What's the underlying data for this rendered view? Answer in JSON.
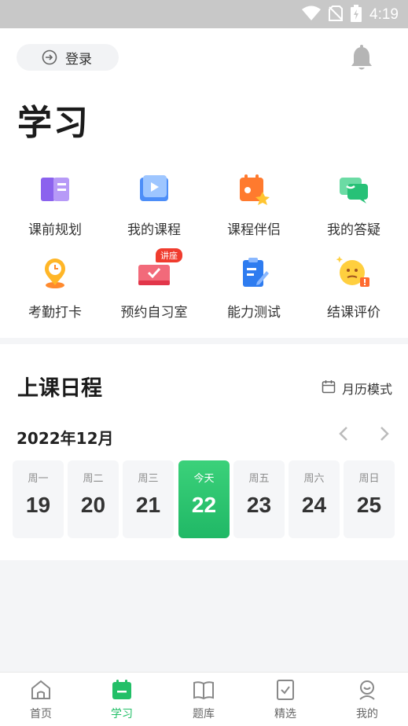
{
  "status_bar": {
    "time": "4:19"
  },
  "header": {
    "login_label": "登录",
    "title": "学习"
  },
  "grid": [
    {
      "label": "课前规划",
      "icon": "plan-icon"
    },
    {
      "label": "我的课程",
      "icon": "video-course-icon"
    },
    {
      "label": "课程伴侣",
      "icon": "companion-icon"
    },
    {
      "label": "我的答疑",
      "icon": "chat-qa-icon"
    },
    {
      "label": "考勤打卡",
      "icon": "clock-pin-icon"
    },
    {
      "label": "预约自习室",
      "icon": "study-room-icon",
      "badge": "讲座"
    },
    {
      "label": "能力测试",
      "icon": "clipboard-test-icon"
    },
    {
      "label": "结课评价",
      "icon": "rating-face-icon"
    }
  ],
  "schedule": {
    "title": "上课日程",
    "mode_label": "月历模式",
    "month": "2022年12月",
    "days": [
      {
        "weekday": "周一",
        "date": "19"
      },
      {
        "weekday": "周二",
        "date": "20"
      },
      {
        "weekday": "周三",
        "date": "21"
      },
      {
        "weekday": "今天",
        "date": "22",
        "today": true
      },
      {
        "weekday": "周五",
        "date": "23"
      },
      {
        "weekday": "周六",
        "date": "24"
      },
      {
        "weekday": "周日",
        "date": "25"
      }
    ]
  },
  "tabbar": [
    {
      "label": "首页",
      "icon": "home-icon"
    },
    {
      "label": "学习",
      "icon": "study-icon",
      "active": true
    },
    {
      "label": "题库",
      "icon": "book-icon"
    },
    {
      "label": "精选",
      "icon": "selected-icon"
    },
    {
      "label": "我的",
      "icon": "profile-icon"
    }
  ],
  "colors": {
    "accent": "#22bf67",
    "badge": "#f03c2e"
  }
}
